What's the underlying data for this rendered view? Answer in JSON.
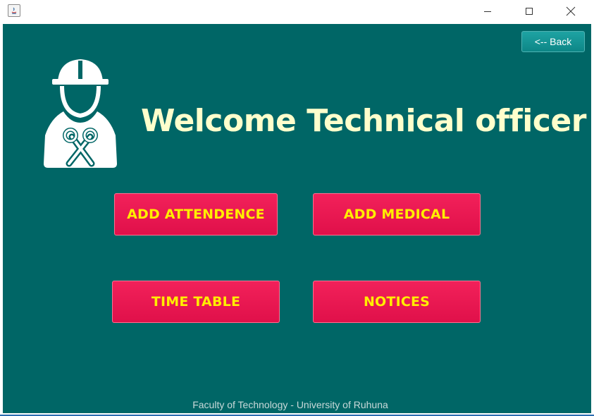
{
  "window": {
    "controls": {
      "minimize_icon": "minimize-icon",
      "maximize_icon": "maximize-icon",
      "close_icon": "close-icon"
    }
  },
  "header": {
    "back_label": "<-- Back",
    "title": "Welcome Technical officer"
  },
  "actions": {
    "add_attendance": "ADD ATTENDENCE",
    "add_medical": "ADD MEDICAL",
    "time_table": "TIME TABLE",
    "notices": "NOTICES"
  },
  "footer": {
    "text": "Faculty of Technology - University of Ruhuna"
  },
  "colors": {
    "background": "#006666",
    "title_text": "#ffffcc",
    "button_bg": "#e8144f",
    "button_text": "#ffee00",
    "back_button_bg": "#139393"
  },
  "icons": {
    "app": "java-app-icon",
    "officer": "technical-officer-icon"
  }
}
